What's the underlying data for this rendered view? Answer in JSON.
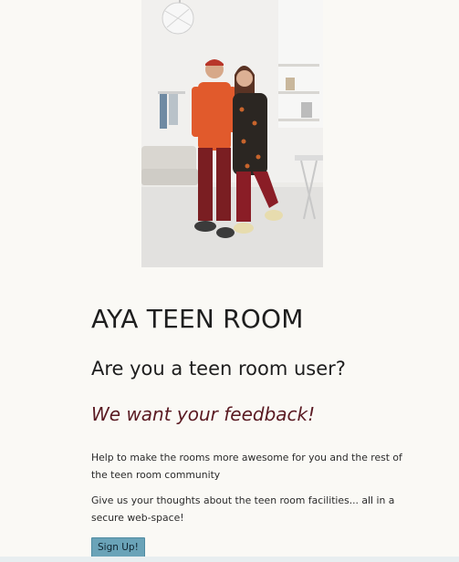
{
  "hero": {
    "image_description_icon": "photo-two-teens-in-room"
  },
  "main": {
    "title": "AYA TEEN ROOM",
    "question": "Are you a teen room user?",
    "tagline": "We want your feedback!",
    "paragraph_1": "Help to make the rooms more awesome for you and the rest of the teen room community",
    "paragraph_2": "Give us your thoughts about the teen room facilities... all in a secure web-space!",
    "signup_label": "Sign Up!"
  },
  "colors": {
    "background": "#faf9f5",
    "tagline": "#5a1a22",
    "button": "#6aa3b8"
  }
}
